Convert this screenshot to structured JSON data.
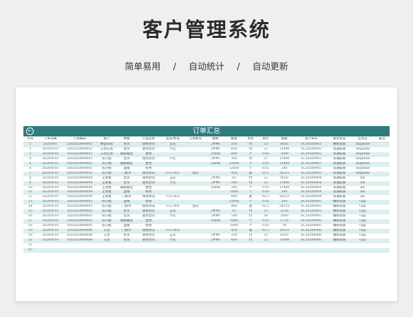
{
  "hero": {
    "title": "客户管理系统",
    "features": [
      "简单易用",
      "/",
      "自动统计",
      "/",
      "自动更新"
    ]
  },
  "sheet": {
    "title": "订单汇总",
    "back_icon": "back-arrow-icon",
    "header_color": "#2f7b80",
    "stripe_color": "#ddeeee",
    "columns": [
      "序号",
      "下单日期",
      "订单编号",
      "客户",
      "种类",
      "产品名称",
      "型号/色号",
      "订单要求",
      "规格",
      "数量",
      "单位",
      "单价",
      "金额",
      "生产单号",
      "发货状态",
      "业务员",
      "备注"
    ],
    "rows": [
      [
        "1",
        "2020/9/1",
        "DD2020090001",
        "腾哲科技",
        "合页",
        "银色合页",
        "五孔",
        "",
        "2##6",
        "350",
        "付",
        "23",
        "8050",
        "SC20200901",
        "做好就发",
        "Angeline",
        ""
      ],
      [
        "2",
        "2020/9/10",
        "DD2020090002",
        "方达信息",
        "合页",
        "金色合页",
        "六孔",
        "",
        "2##6",
        "600",
        "付",
        "23",
        "13440",
        "SC20200902",
        "等通知发",
        "Angeline",
        ""
      ],
      [
        "3",
        "2020/9/10",
        "DD2020090002",
        "方达信息",
        "膨胀螺丝",
        "金色",
        "",
        "",
        "35mm",
        "800",
        "个",
        "0.95",
        "7600",
        "SC20200902",
        "等通知发",
        "Angeline",
        ""
      ],
      [
        "4",
        "2020/9/10",
        "DD2020090003",
        "陈小姐",
        "合页",
        "银色合页",
        "六孔",
        "",
        "2##6",
        "360",
        "付",
        "23",
        "13440",
        "SC20200903",
        "等通知发",
        "Angeline",
        ""
      ],
      [
        "5",
        "2020/9/10",
        "DD2020090003",
        "陈小姐",
        "膨胀螺丝",
        "金色",
        "",
        "",
        "35mm",
        "12000",
        "个",
        "0.95",
        "11400",
        "SC20200903",
        "等通知发",
        "Angeline",
        ""
      ],
      [
        "6",
        "2020/9/10",
        "DD2020090003",
        "陈小姐",
        "盒帽",
        "棕色",
        "",
        "",
        "",
        "12000",
        "个",
        "0.03",
        "360",
        "SC20200903",
        "等通知发",
        "Angeline",
        ""
      ],
      [
        "7",
        "2020/9/10",
        "DD2020090003",
        "陈小姐",
        "门把手",
        "银色单向",
        "TCL-001",
        "左向",
        "",
        "450",
        "套",
        "62.5",
        "28125",
        "SC20200903",
        "等通知发",
        "Angeline",
        ""
      ],
      [
        "8",
        "2020/9/10",
        "DD2020090004",
        "王老板",
        "合页",
        "银色合页",
        "五孔",
        "",
        "2##6",
        "92",
        "付",
        "23",
        "8050",
        "SC20200904",
        "等通知发",
        "KK",
        ""
      ],
      [
        "9",
        "2020/9/10",
        "DD2020090004",
        "王老板",
        "合页",
        "金色合页",
        "六孔",
        "",
        "2##6",
        "100",
        "付",
        "23",
        "13440",
        "SC20200904",
        "等通知发",
        "KK",
        ""
      ],
      [
        "10",
        "2020/9/10",
        "DD2020090004",
        "王老板",
        "膨胀螺丝",
        "金色",
        "",
        "",
        "35mm",
        "200",
        "个",
        "0.95",
        "11400",
        "SC20200904",
        "等通知发",
        "KK",
        ""
      ],
      [
        "11",
        "2020/9/10",
        "DD2020090004",
        "王老板",
        "盒帽",
        "棕色",
        "",
        "",
        "",
        "1800",
        "个",
        "0.03",
        "360",
        "SC20200904",
        "等通知发",
        "KK",
        ""
      ],
      [
        "12",
        "2020/9/10",
        "DD2020090004",
        "王老板",
        "门把手",
        "银色单向",
        "TCL-002",
        "",
        "",
        "600",
        "套",
        "62.5",
        "28125",
        "SC20200904",
        "等通知发",
        "KK",
        ""
      ],
      [
        "13",
        "2020/9/10",
        "DD2020090005",
        "陈小姐",
        "盒帽",
        "棕色",
        "",
        "",
        "",
        "13000",
        "个",
        "0.03",
        "360",
        "SC20200905",
        "做好就发",
        "Gigi",
        ""
      ],
      [
        "14",
        "2020/9/10",
        "DD2020090005",
        "陈小姐",
        "门把手",
        "银色单向",
        "TCL-001",
        "左向",
        "",
        "400",
        "套",
        "62.5",
        "28125",
        "SC20200905",
        "做好就发",
        "Gigi",
        ""
      ],
      [
        "15",
        "2020/9/10",
        "DD2020090005",
        "陈小姐",
        "合页",
        "银色合页",
        "五孔",
        "",
        "2##6",
        "92",
        "付",
        "23",
        "2116",
        "SC20200905",
        "做好就发",
        "Gigi",
        ""
      ],
      [
        "16",
        "2020/9/10",
        "DD2020090005",
        "陈小姐",
        "合页",
        "金色合页",
        "六孔",
        "",
        "2##6",
        "100",
        "付",
        "28",
        "2800",
        "SC20200905",
        "做好就发",
        "Gigi",
        ""
      ],
      [
        "17",
        "2020/9/10",
        "DD2020090005",
        "陈小姐",
        "膨胀螺丝",
        "金色",
        "",
        "",
        "35mm",
        "1800",
        "个",
        "0.95",
        "1710",
        "SC20200905",
        "做好就发",
        "Gigi",
        ""
      ],
      [
        "18",
        "2020/9/10",
        "DD2020090005",
        "陈小姐",
        "盒帽",
        "棕色",
        "",
        "",
        "",
        "1800",
        "个",
        "0.03",
        "54",
        "SC20200905",
        "做好就发",
        "Gigi",
        ""
      ],
      [
        "19",
        "2020/9/10",
        "DD2020090006",
        "方达",
        "门把手",
        "银色单向",
        "TCL-002",
        "",
        "",
        "450",
        "套",
        "62.5",
        "28125",
        "SC20200906",
        "做好就发",
        "Gigi",
        ""
      ],
      [
        "20",
        "2020/9/10",
        "DD2020090006",
        "方达",
        "合页",
        "银色合页",
        "五孔",
        "",
        "2##6",
        "350",
        "付",
        "23",
        "8050",
        "SC20200906",
        "做好就发",
        "Gigi",
        ""
      ],
      [
        "21",
        "2020/9/10",
        "DD2020090006",
        "方达",
        "合页",
        "金色合页",
        "六孔",
        "",
        "2##6",
        "600",
        "付",
        "23",
        "13440",
        "SC20200906",
        "做好就发",
        "Gigi",
        ""
      ],
      [
        "22",
        "",
        "",
        "",
        "",
        "",
        "",
        "",
        "",
        "",
        "",
        "",
        "",
        "",
        "",
        "",
        ""
      ],
      [
        "23",
        "",
        "",
        "",
        "",
        "",
        "",
        "",
        "",
        "",
        "",
        "",
        "",
        "",
        "",
        "",
        ""
      ]
    ]
  }
}
